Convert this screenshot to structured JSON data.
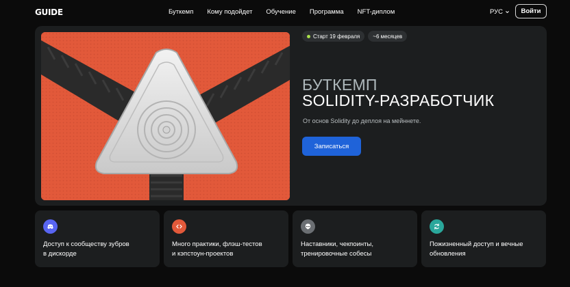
{
  "header": {
    "logo": "GUIDE",
    "nav": [
      "Буткемп",
      "Кому подойдет",
      "Обучение",
      "Программа",
      "NFT-диплом"
    ],
    "lang": "РУС",
    "login_label": "Войти"
  },
  "hero": {
    "badges": [
      "Старт 19 февраля",
      "~6 месяцев"
    ],
    "title_line1": "БУТКЕМП",
    "title_line2": "SOLIDITY-РАЗРАБОТЧИК",
    "subtitle": "От основ Solidity до деплоя на мейннете.",
    "cta_label": "Записаться",
    "image_bg": "#e2593a"
  },
  "features": [
    {
      "icon": "discord-icon",
      "color": "#5865f2",
      "line1": "Доступ к сообществу зубров",
      "line2": "в дискорде"
    },
    {
      "icon": "code-icon",
      "color": "#e2593a",
      "line1": "Много практики, флэш-тестов",
      "line2": "и кэпстоун-проектов"
    },
    {
      "icon": "alien-icon",
      "color": "#6b6f73",
      "line1": "Наставники, чекпоинты,",
      "line2": "тренировочные собесы"
    },
    {
      "icon": "refresh-icon",
      "color": "#2aa79b",
      "line1": "Пожизненный доступ и вечные",
      "line2": "обновления"
    }
  ]
}
